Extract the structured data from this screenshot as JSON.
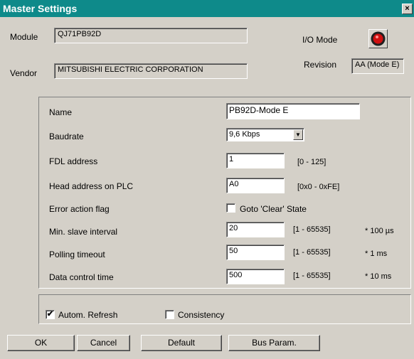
{
  "window": {
    "title": "Master Settings",
    "close_label": "×"
  },
  "header": {
    "module_label": "Module",
    "module_value": "QJ71PB92D",
    "vendor_label": "Vendor",
    "vendor_value": "MITSUBISHI ELECTRIC CORPORATION",
    "io_mode_label": "I/O Mode",
    "revision_label": "Revision",
    "revision_value": "AA (Mode E)"
  },
  "params": {
    "name_label": "Name",
    "name_value": "PB92D-Mode E",
    "baudrate_label": "Baudrate",
    "baudrate_value": "9,6 Kbps",
    "fdl_label": "FDL address",
    "fdl_value": "1",
    "fdl_range": "[0 - 125]",
    "head_label": "Head address on PLC",
    "head_value": "A0",
    "head_range": "[0x0 - 0xFE]",
    "error_label": "Error action flag",
    "error_check_label": "Goto 'Clear' State",
    "minslave_label": "Min. slave interval",
    "minslave_value": "20",
    "minslave_range": "[1 - 65535]",
    "minslave_unit": "* 100 µs",
    "polling_label": "Polling timeout",
    "polling_value": "50",
    "polling_range": "[1 - 65535]",
    "polling_unit": "* 1 ms",
    "datacontrol_label": "Data control time",
    "datacontrol_value": "500",
    "datacontrol_range": "[1 - 65535]",
    "datacontrol_unit": "* 10 ms"
  },
  "options": {
    "autom_refresh_label": "Autom. Refresh",
    "autom_refresh_checked": true,
    "consistency_label": "Consistency",
    "consistency_checked": false,
    "checkmark": "✔"
  },
  "buttons": {
    "ok": "OK",
    "cancel": "Cancel",
    "default": "Default",
    "bus_param": "Bus Param."
  },
  "colors": {
    "titlebar": "#0e8a8a",
    "dialog_bg": "#d4d0c8",
    "io_led": "#d01010"
  }
}
